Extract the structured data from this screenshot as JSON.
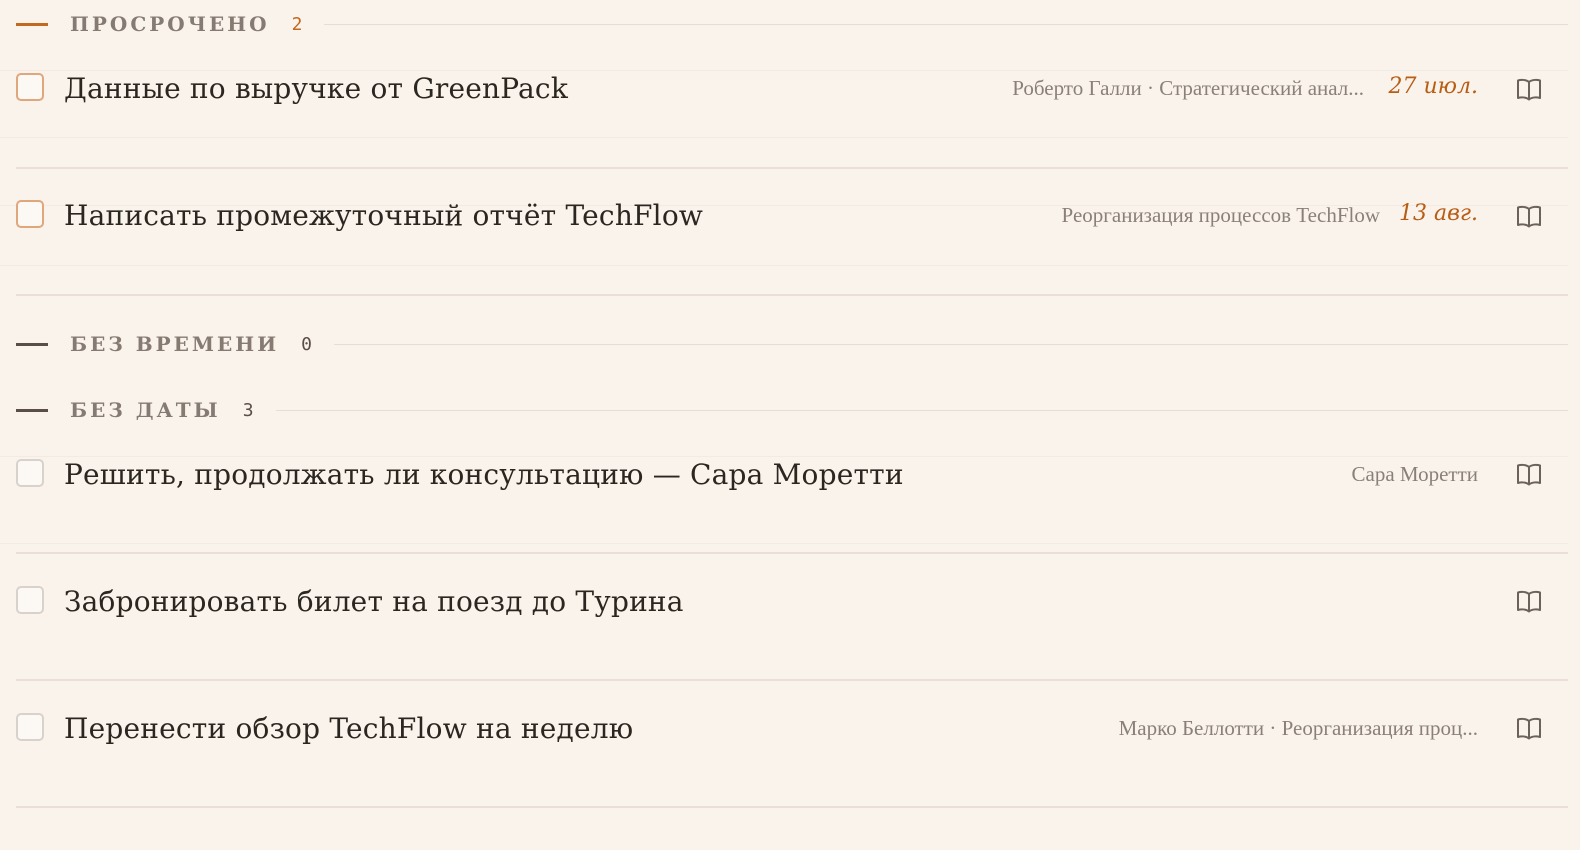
{
  "sections": {
    "overdue": {
      "title": "ПРОСРОЧЕНО",
      "count": "2"
    },
    "no_time": {
      "title": "БЕЗ ВРЕМЕНИ",
      "count": "0"
    },
    "no_date": {
      "title": "БЕЗ ДАТЫ",
      "count": "3"
    }
  },
  "tasks": [
    {
      "title": "Данные по выручке от GreenPack",
      "meta": "Роберто Галли · Стратегический анал...",
      "date": "27 июл."
    },
    {
      "title": "Написать промежуточный отчёт TechFlow",
      "meta": "Реорганизация процессов TechFlow",
      "date": "13 авг."
    },
    {
      "title": "Решить, продолжать ли консультацию — Сара Моретти",
      "meta": "Сара Моретти",
      "date": ""
    },
    {
      "title": "Забронировать билет на поезд до Турина",
      "meta": "",
      "date": ""
    },
    {
      "title": "Перенести обзор TechFlow на неделю",
      "meta": "Марко Беллотти · Реорганизация проц...",
      "date": ""
    }
  ],
  "colors": {
    "accent": "#c2691f",
    "date": "#b85d14",
    "background": "#faf3ec"
  },
  "icons": {
    "row_action": "book-icon",
    "section_marker": "dash"
  }
}
